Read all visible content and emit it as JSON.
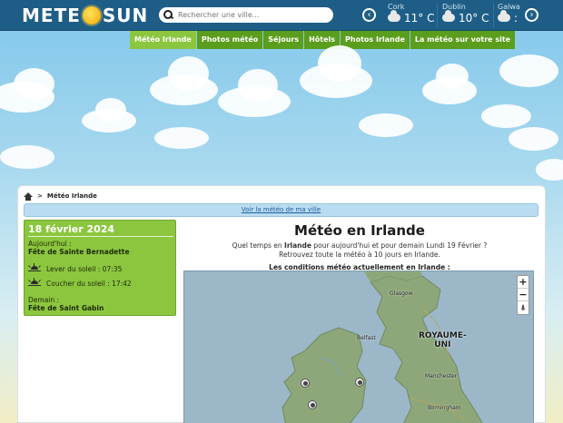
{
  "header": {
    "logo_left": "METE",
    "logo_right": "SUN",
    "search_placeholder": "Rechercher une ville...",
    "cities": [
      {
        "name": "Cork",
        "temp": "11° C"
      },
      {
        "name": "Dublin",
        "temp": "10° C"
      },
      {
        "name": "Galwa",
        "temp": ":"
      }
    ]
  },
  "menu": {
    "items": [
      "Météo Irlande",
      "Photos météo",
      "Séjours",
      "Hôtels",
      "Photos Irlande",
      "La météo sur votre site"
    ]
  },
  "breadcrumb": {
    "current": "Météo Irlande",
    "separator": ">"
  },
  "my_city_link": "Voir la météo de ma ville",
  "day": {
    "date": "18 février 2024",
    "today_label": "Aujourd'hui :",
    "today_saint": "Fête de Sainte Bernadette",
    "sunrise": "Lever du soleil : 07:35",
    "sunset": "Coucher du soleil : 17:42",
    "tomorrow_label": "Demain :",
    "tomorrow_saint": "Fête de Saint Gabin"
  },
  "main": {
    "title": "Météo en Irlande",
    "intro_1a": "Quel temps en ",
    "intro_1b": "Irlande",
    "intro_1c": " pour aujourd'hui et pour demain Lundi 19 Février ?",
    "intro_2": "Retrouvez toute la météo à 10 jours en Irlande.",
    "conditions": "Les conditions météo actuellement en Irlande :"
  },
  "map": {
    "zoom_in": "+",
    "zoom_out": "−",
    "reset": "⍋",
    "labels": {
      "glasgow": "Glasgow",
      "belfast": "Belfast",
      "uk_1": "ROYAUME-",
      "uk_2": "UNI",
      "manchester": "Manchester",
      "birmingham": "Birmingham"
    }
  },
  "icons": {
    "search": "search-icon",
    "prev": "chevron-left-icon",
    "next": "chevron-right-icon",
    "home": "home-icon"
  }
}
